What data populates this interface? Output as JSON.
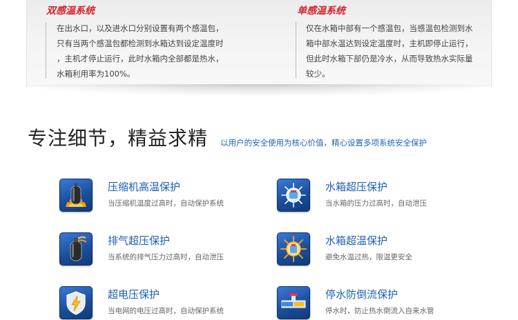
{
  "compare": {
    "dual": {
      "title": "双感温系统",
      "lines": [
        "在出水口，以及进水口分别设置有两个感温包，",
        "只有当两个感温包都检测到水箱达到设定温度时",
        "，主机才停止运行，此时水箱内全部都是热水，",
        "水箱利用率为100%。"
      ]
    },
    "single": {
      "title": "单感温系统",
      "lines": [
        "仅在水箱中部有一个感温包，当感温包检测到水",
        "箱中部水温达到设定温度时，主机即停止运行，",
        "但此时水箱下部仍是冷水，从而导致热水实际量",
        "较少。"
      ]
    }
  },
  "section": {
    "title": "专注细节，精益求精",
    "subtitle": "以用户的安全使用为核心价值，精心设置多项系统安全保护"
  },
  "features": [
    {
      "title": "压缩机高温保护",
      "desc": "当压缩机温度过高时，自动保护系统",
      "icon": "compressor-flame-icon"
    },
    {
      "title": "水箱超压保护",
      "desc": "当水箱的压力过高时，自动泄压",
      "icon": "tank-pressure-icon"
    },
    {
      "title": "排气超压保护",
      "desc": "当系统的排气压力过高时，自动泄压",
      "icon": "exhaust-cylinder-icon"
    },
    {
      "title": "水箱超温保护",
      "desc": "避免水温过热，限温更安全",
      "icon": "tank-temperature-icon"
    },
    {
      "title": "超电压保护",
      "desc": "当电网的电压过高时，自动保护系统",
      "icon": "lightning-shield-icon"
    },
    {
      "title": "停水防倒流保护",
      "desc": "停水时，防止热水倒流入自来水管",
      "icon": "pipe-backflow-icon"
    }
  ]
}
